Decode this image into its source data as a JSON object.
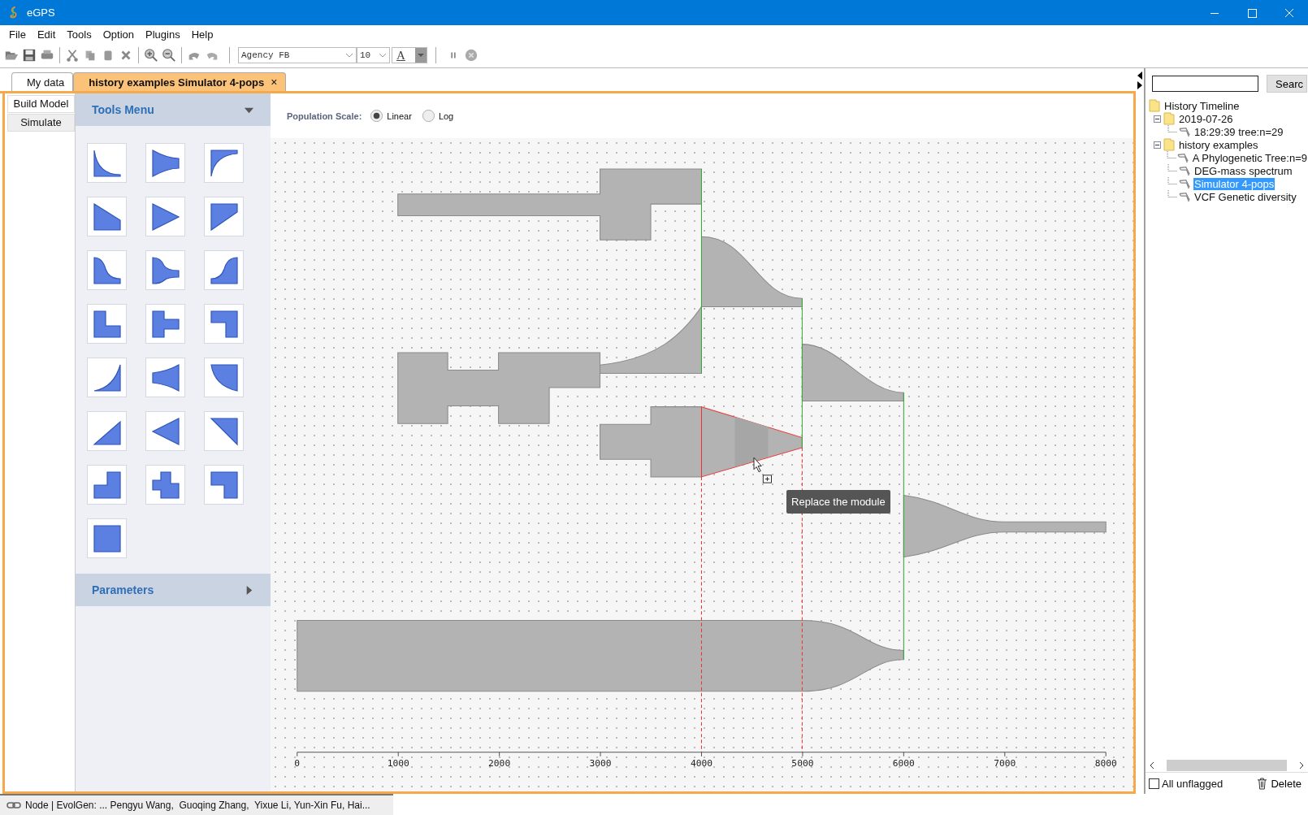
{
  "window": {
    "title": "eGPS"
  },
  "menu": [
    "File",
    "Edit",
    "Tools",
    "Option",
    "Plugins",
    "Help"
  ],
  "toolbar": {
    "font": "Agency FB",
    "size": "10",
    "text_color_label": "A"
  },
  "tabs": [
    {
      "label": "My data",
      "selected": false
    },
    {
      "label": "history examples Simulator 4-pops",
      "selected": true,
      "close": "×"
    }
  ],
  "side_tabs": [
    {
      "label": "Build Model",
      "selected": true
    },
    {
      "label": "Simulate",
      "selected": false
    }
  ],
  "tools_menu": {
    "title": "Tools Menu",
    "expanded": true
  },
  "parameters": {
    "title": "Parameters",
    "expanded": false
  },
  "population_scale": {
    "label": "Population Scale:",
    "options": [
      {
        "label": "Linear",
        "selected": true
      },
      {
        "label": "Log",
        "selected": false
      }
    ]
  },
  "canvas": {
    "axis_ticks": [
      "0",
      "1000",
      "2000",
      "3000",
      "4000",
      "5000",
      "6000",
      "7000",
      "8000"
    ],
    "tooltip": "Replace the module"
  },
  "history": {
    "search_button": "Searc",
    "tree": [
      {
        "label": "History Timeline",
        "kind": "folder",
        "selected": false,
        "children": [
          {
            "label": "2019-07-26",
            "kind": "folder",
            "selected": false,
            "expanded": true,
            "children": [
              {
                "label": "18:29:39 tree:n=29",
                "kind": "record",
                "selected": false
              }
            ]
          },
          {
            "label": "history examples",
            "kind": "folder",
            "selected": false,
            "expanded": true,
            "children": [
              {
                "label": "A Phylogenetic Tree:n=9",
                "kind": "record",
                "selected": false
              },
              {
                "label": "DEG-mass spectrum",
                "kind": "record",
                "selected": false
              },
              {
                "label": "Simulator 4-pops",
                "kind": "record",
                "selected": true
              },
              {
                "label": "VCF Genetic diversity",
                "kind": "record",
                "selected": false
              }
            ]
          }
        ]
      }
    ],
    "flag_filter": {
      "label": "All unflagged",
      "checked": false
    },
    "delete_button": "Delete"
  },
  "status_bar": {
    "text": "Node | EvolGen: ... Pengyu Wang,  Guoqing Zhang,  Yixue Li, Yun-Xin Fu, Hai..."
  }
}
